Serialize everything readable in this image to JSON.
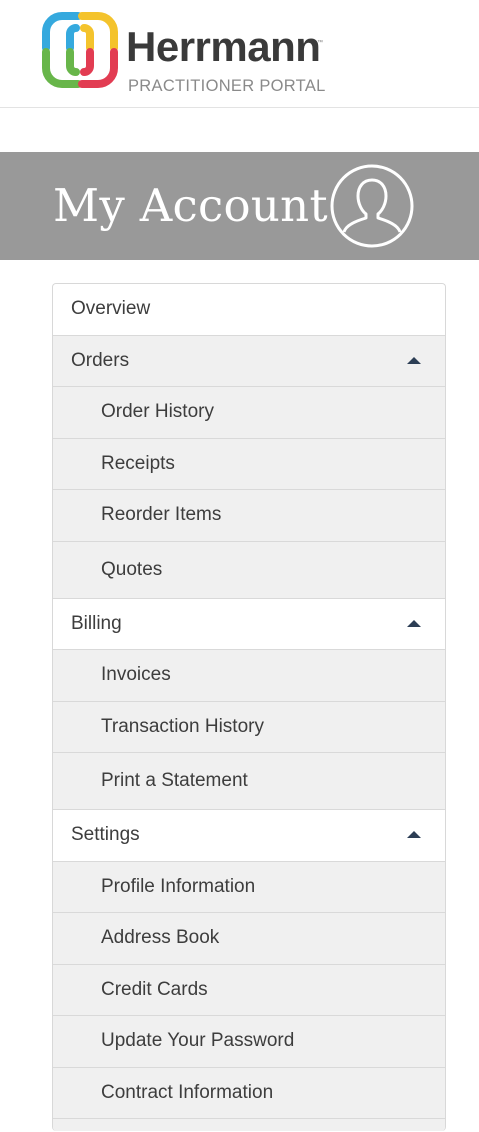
{
  "brand": {
    "name": "Herrmann",
    "trademark": "™",
    "subtitle": "PRACTITIONER PORTAL",
    "logo_colors": [
      "#35a9de",
      "#f4c32c",
      "#68b64a",
      "#e23c52"
    ]
  },
  "banner": {
    "title": "My Account",
    "icon": "user-silhouette-icon",
    "background": "#999999"
  },
  "menu": {
    "overview": {
      "label": "Overview"
    },
    "orders": {
      "label": "Orders",
      "expanded": true,
      "items": [
        {
          "label": "Order History"
        },
        {
          "label": "Receipts"
        },
        {
          "label": "Reorder Items"
        },
        {
          "label": "Quotes"
        }
      ]
    },
    "billing": {
      "label": "Billing",
      "expanded": true,
      "items": [
        {
          "label": "Invoices"
        },
        {
          "label": "Transaction History"
        },
        {
          "label": "Print a Statement"
        }
      ]
    },
    "settings": {
      "label": "Settings",
      "expanded": true,
      "items": [
        {
          "label": "Profile Information"
        },
        {
          "label": "Address Book"
        },
        {
          "label": "Credit Cards"
        },
        {
          "label": "Update Your Password"
        },
        {
          "label": "Contract Information"
        }
      ]
    },
    "caret_color": "#2c3e55"
  }
}
